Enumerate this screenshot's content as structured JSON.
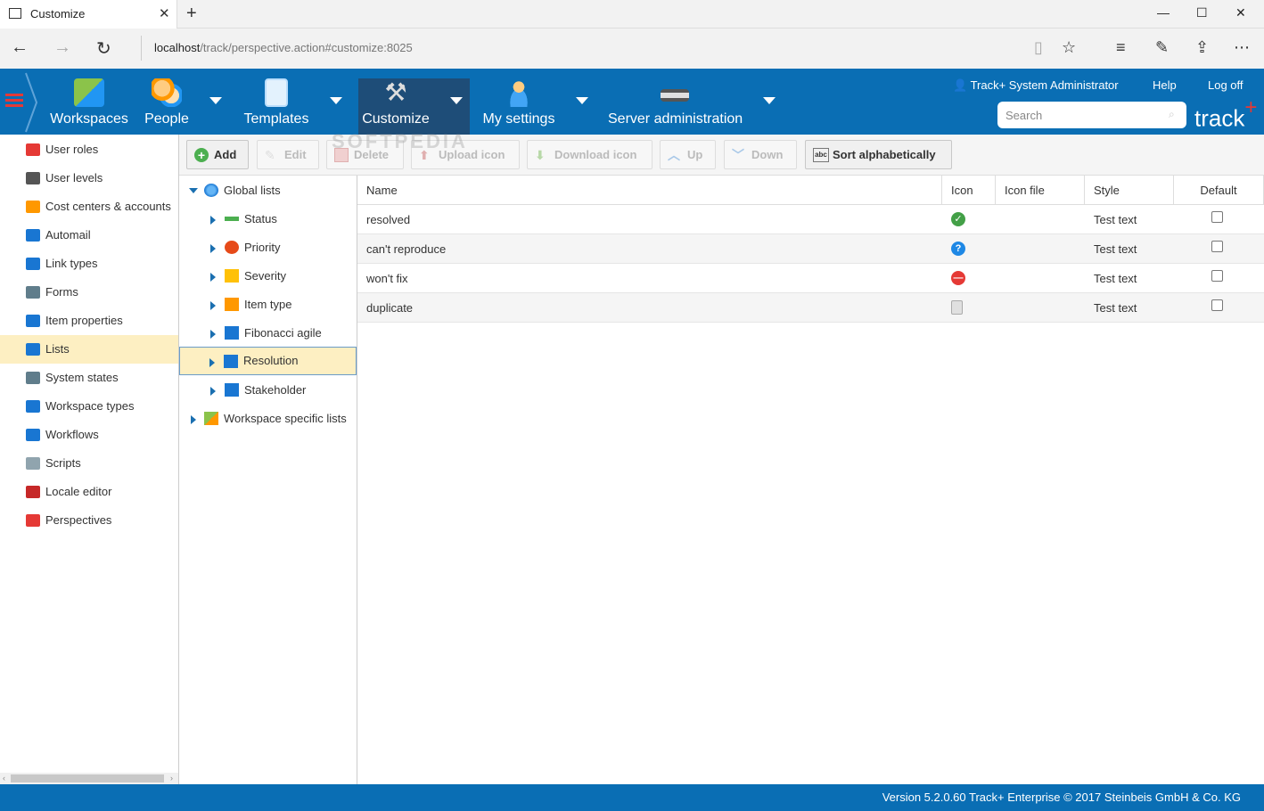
{
  "browser": {
    "tab_title": "Customize",
    "new_tab": "+",
    "url_host": "localhost",
    "url_path": "/track/perspective.action#customize:8025"
  },
  "header": {
    "nav": [
      {
        "label": "Workspaces",
        "icon": "workspaces-icon"
      },
      {
        "label": "People",
        "icon": "people-icon"
      },
      {
        "label": "Templates",
        "icon": "templates-icon"
      },
      {
        "label": "Customize",
        "icon": "customize-icon"
      },
      {
        "label": "My settings",
        "icon": "my-settings-icon"
      },
      {
        "label": "Server administration",
        "icon": "server-icon"
      }
    ],
    "user": "Track+ System Administrator",
    "help": "Help",
    "logoff": "Log off",
    "search_placeholder": "Search",
    "logo_text": "track",
    "logo_plus": "+",
    "colors": {
      "bar": "#0a6eb4",
      "active_nav": "#1e4d78",
      "accent": "#e53935"
    }
  },
  "sidebar": {
    "items": [
      {
        "label": "User roles",
        "icon": "user-roles-icon"
      },
      {
        "label": "User levels",
        "icon": "user-levels-icon"
      },
      {
        "label": "Cost centers & accounts",
        "icon": "cost-centers-icon"
      },
      {
        "label": "Automail",
        "icon": "automail-icon"
      },
      {
        "label": "Link types",
        "icon": "link-types-icon"
      },
      {
        "label": "Forms",
        "icon": "forms-icon"
      },
      {
        "label": "Item properties",
        "icon": "item-properties-icon"
      },
      {
        "label": "Lists",
        "icon": "lists-icon",
        "active": true
      },
      {
        "label": "System states",
        "icon": "system-states-icon"
      },
      {
        "label": "Workspace types",
        "icon": "workspace-types-icon"
      },
      {
        "label": "Workflows",
        "icon": "workflows-icon"
      },
      {
        "label": "Scripts",
        "icon": "scripts-icon"
      },
      {
        "label": "Locale editor",
        "icon": "locale-editor-icon"
      },
      {
        "label": "Perspectives",
        "icon": "perspectives-icon"
      }
    ]
  },
  "toolbar": {
    "add": "Add",
    "edit": "Edit",
    "delete": "Delete",
    "upload_icon": "Upload icon",
    "download_icon": "Download icon",
    "up": "Up",
    "down": "Down",
    "sort": "Sort alphabetically",
    "sort_icon_text": "abc"
  },
  "tree": {
    "root": "Global lists",
    "children": [
      "Status",
      "Priority",
      "Severity",
      "Item type",
      "Fibonacci agile",
      "Resolution",
      "Stakeholder"
    ],
    "selected": "Resolution",
    "workspace_lists": "Workspace specific lists"
  },
  "grid": {
    "columns": [
      "Name",
      "Icon",
      "Icon file",
      "Style",
      "Default"
    ],
    "rows": [
      {
        "name": "resolved",
        "icon": "check-icon",
        "style": "Test text",
        "default": false
      },
      {
        "name": "can't reproduce",
        "icon": "question-icon",
        "style": "Test text",
        "default": false
      },
      {
        "name": "won't fix",
        "icon": "no-entry-icon",
        "style": "Test text",
        "default": false
      },
      {
        "name": "duplicate",
        "icon": "duplicate-icon",
        "style": "Test text",
        "default": false
      }
    ]
  },
  "footer": {
    "text": "Version 5.2.0.60 Track+ Enterprise  © 2017 Steinbeis GmbH & Co. KG"
  },
  "watermark": "SOFTPEDIA"
}
